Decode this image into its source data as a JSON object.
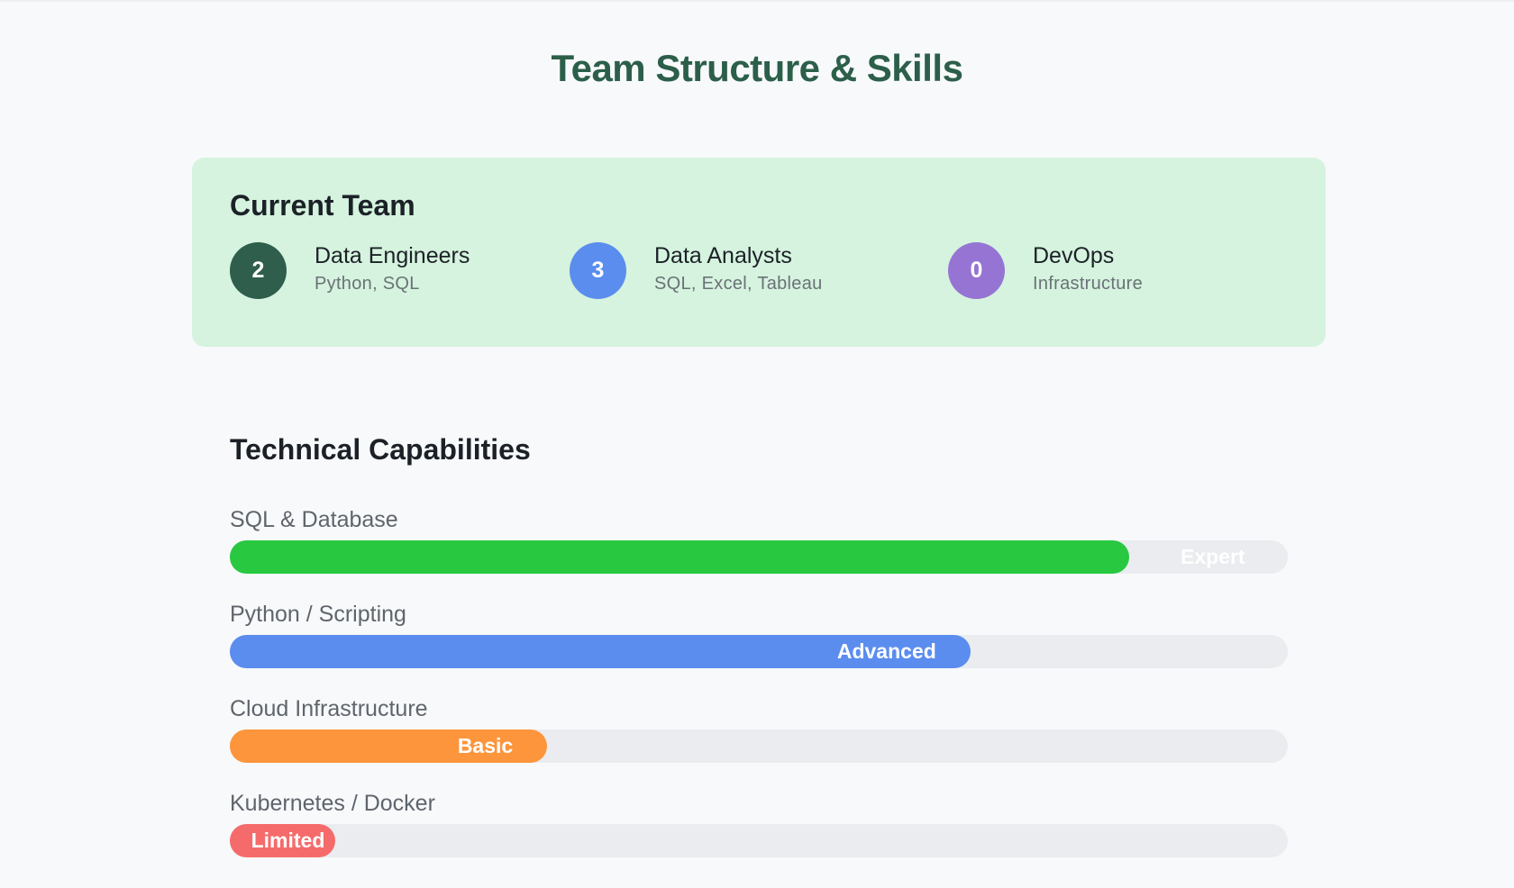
{
  "page": {
    "title": "Team Structure & Skills"
  },
  "team": {
    "heading": "Current Team",
    "members": [
      {
        "count": "2",
        "role": "Data Engineers",
        "skills": "Python, SQL",
        "color": "#2f5e4d"
      },
      {
        "count": "3",
        "role": "Data Analysts",
        "skills": "SQL, Excel, Tableau",
        "color": "#5b8def"
      },
      {
        "count": "0",
        "role": "DevOps",
        "skills": "Infrastructure",
        "color": "#9674d4"
      }
    ]
  },
  "capabilities": {
    "heading": "Technical Capabilities",
    "items": [
      {
        "label": "SQL & Database",
        "level": "Expert",
        "fill_percent": 85,
        "color": "#28c840"
      },
      {
        "label": "Python / Scripting",
        "level": "Advanced",
        "fill_percent": 70,
        "color": "#5b8def"
      },
      {
        "label": "Cloud Infrastructure",
        "level": "Basic",
        "fill_percent": 30,
        "color": "#fd953c"
      },
      {
        "label": "Kubernetes / Docker",
        "level": "Limited",
        "fill_percent": 10,
        "color": "#f56b6b"
      }
    ]
  }
}
